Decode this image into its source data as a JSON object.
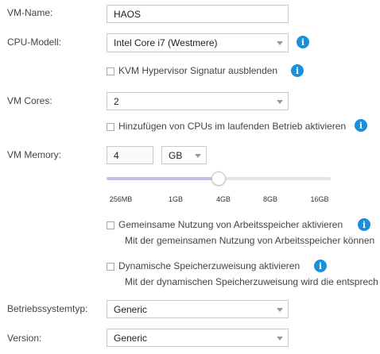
{
  "form": {
    "vm_name": {
      "label": "VM-Name:",
      "value": "HAOS"
    },
    "cpu_model": {
      "label": "CPU-Modell:",
      "value": "Intel Core i7 (Westmere)"
    },
    "kvm_hide": {
      "label": "KVM Hypervisor Signatur ausblenden",
      "checked": false
    },
    "vm_cores": {
      "label": "VM Cores:",
      "value": "2"
    },
    "cpu_hotplug": {
      "label": "Hinzufügen von CPUs im laufenden Betrieb aktivieren",
      "checked": false
    },
    "vm_memory": {
      "label": "VM Memory:",
      "value": "4",
      "unit": "GB",
      "slider_fraction": 0.5,
      "ticks": [
        "256MB",
        "1GB",
        "4GB",
        "8GB",
        "16GB"
      ]
    },
    "shared_memory": {
      "label": "Gemeinsame Nutzung von Arbeitsspeicher aktivieren",
      "checked": false,
      "description": "Mit der gemeinsamen Nutzung von Arbeitsspeicher können"
    },
    "dynamic_memory": {
      "label": "Dynamische Speicherzuweisung aktivieren",
      "checked": false,
      "description": "Mit der dynamischen Speicherzuweisung wird die entsprech"
    },
    "os_type": {
      "label": "Betriebssystemtyp:",
      "value": "Generic"
    },
    "version": {
      "label": "Version:",
      "value": "Generic"
    }
  },
  "icons": {
    "info": "info-icon",
    "caret": "chevron-down-icon"
  },
  "colors": {
    "info_blue": "#1a8fdd",
    "slider_fill": "#c7bfe0"
  },
  "info_glyph": "i"
}
